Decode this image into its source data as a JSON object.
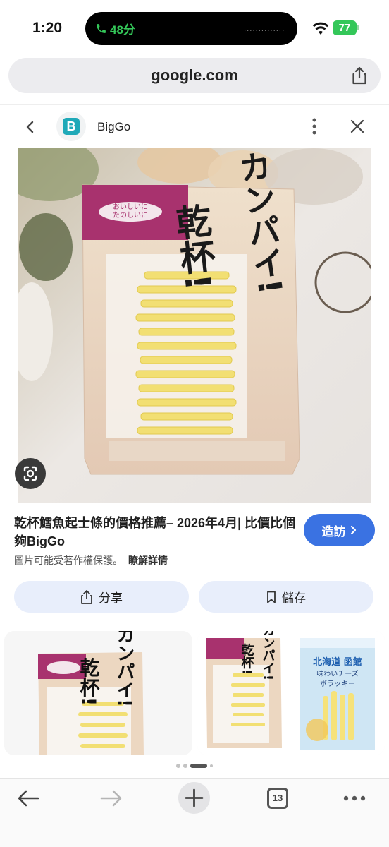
{
  "status_bar": {
    "time": "1:20",
    "call_duration": "48分",
    "battery": "77",
    "colors": {
      "call": "#34c759",
      "battery": "#34c759"
    }
  },
  "browser": {
    "url": "google.com"
  },
  "panel": {
    "site_name": "BigGo",
    "site_logo_letter": "B",
    "logo_color": "#1fa9b8"
  },
  "main_image": {
    "package_texts": [
      "カンパイ!",
      "乾杯!",
      "おいしいに",
      "たのしいに"
    ]
  },
  "result": {
    "title": "乾杯鱈魚起士條的價格推薦– 2026年4月| 比價比個夠BigGo",
    "visit_label": "造訪",
    "copyright_note": "圖片可能受著作權保護。",
    "learn_more": "瞭解詳情",
    "share_label": "分享",
    "save_label": "儲存",
    "accent_color": "#3a72e2"
  },
  "related": {
    "card2_product_lines": [
      "北海道 函館",
      "味わいチーズ",
      "ポラッキー"
    ]
  },
  "toolbar": {
    "tab_count": "13"
  }
}
